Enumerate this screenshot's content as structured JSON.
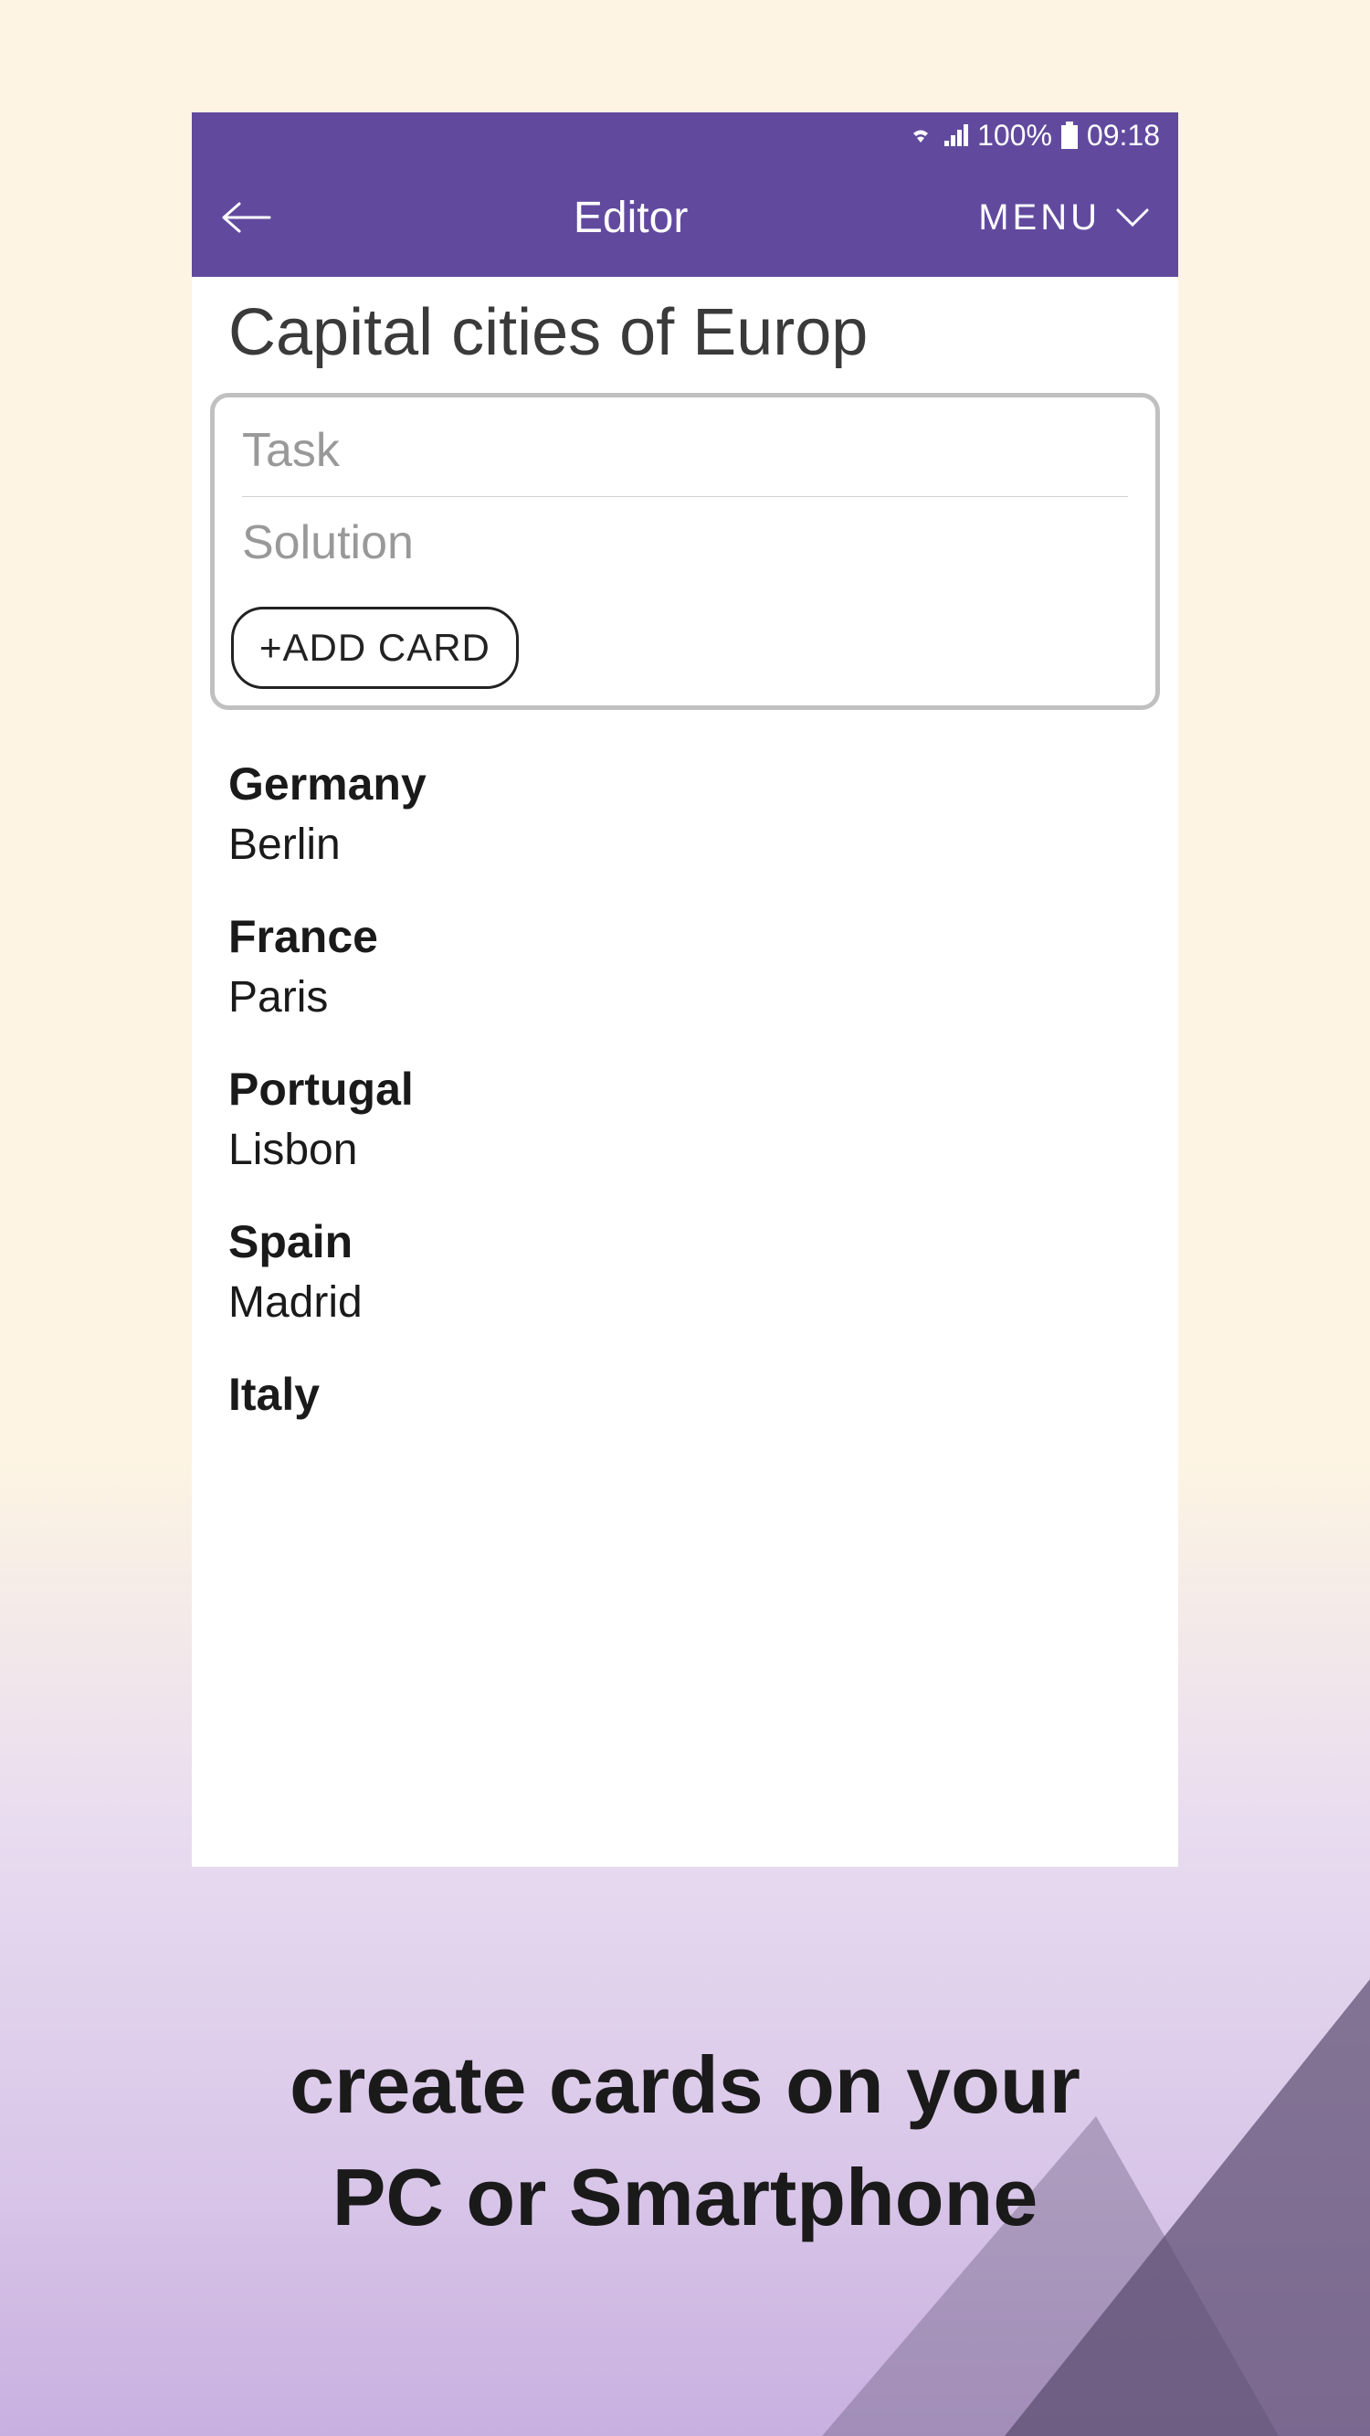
{
  "status_bar": {
    "battery_percent": "100%",
    "time": "09:18"
  },
  "header": {
    "title": "Editor",
    "menu_label": "MENU"
  },
  "content": {
    "deck_title": "Capital cities of Europ",
    "task_placeholder": "Task",
    "solution_placeholder": "Solution",
    "add_card_label": "+ADD CARD",
    "cards": [
      {
        "task": "Germany",
        "solution": "Berlin"
      },
      {
        "task": "France",
        "solution": "Paris"
      },
      {
        "task": "Portugal",
        "solution": "Lisbon"
      },
      {
        "task": "Spain",
        "solution": "Madrid"
      },
      {
        "task": "Italy",
        "solution": ""
      }
    ]
  },
  "promo": {
    "line1": "create cards on your",
    "line2": "PC or Smartphone"
  }
}
